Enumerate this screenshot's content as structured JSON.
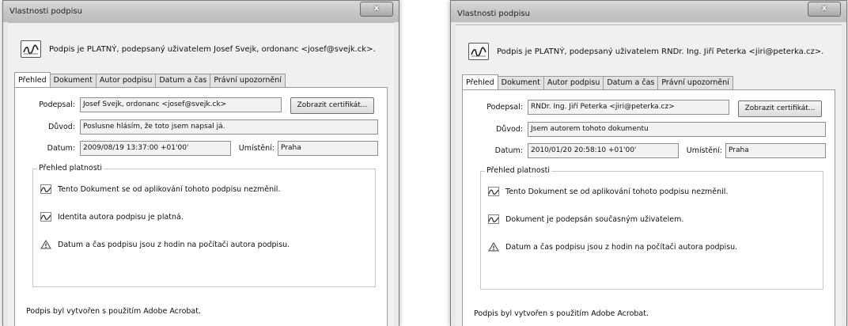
{
  "left": {
    "window_title": "Vlastnosti podpisu",
    "close_glyph": "x",
    "status": "Podpis je PLATNÝ, podepsaný uživatelem Josef Svejk, ordonanc <josef@svejk.ck>.",
    "tabs": [
      "Přehled",
      "Dokument",
      "Autor podpisu",
      "Datum a čas",
      "Právní upozornění"
    ],
    "signed_by_label": "Podepsal:",
    "signed_by_value": "Josef Svejk, ordonanc <josef@svejk.ck>",
    "show_cert_button": "Zobrazit certifikát...",
    "reason_label": "Důvod:",
    "reason_value": "Poslusne hlásím, že toto jsem napsal já.",
    "date_label": "Datum:",
    "date_value": "2009/08/19 13:37:00 +01'00'",
    "location_label": "Umístění:",
    "location_value": "Praha",
    "validity_title": "Přehled platnosti",
    "validity_items": [
      {
        "icon": "signature-ok-icon",
        "text": "Tento Dokument se od aplikování tohoto podpisu nezměnil."
      },
      {
        "icon": "signature-ok-icon",
        "text": "Identita autora podpisu je platná."
      },
      {
        "icon": "warning-icon",
        "text": "Datum a čas podpisu jsou z hodin na počítači autora podpisu."
      }
    ],
    "footer": "Podpis byl vytvořen s použitím Adobe Acrobat."
  },
  "right": {
    "window_title": "Vlastnosti podpisu",
    "close_glyph": "x",
    "status": "Podpis je PLATNÝ, podepsaný uživatelem RNDr. Ing. Jiří Peterka <jiri@peterka.cz>.",
    "tabs": [
      "Přehled",
      "Dokument",
      "Autor podpisu",
      "Datum a čas",
      "Právní upozornění"
    ],
    "signed_by_label": "Podepsal:",
    "signed_by_value": "RNDr. Ing. Jiří Peterka <jiri@peterka.cz>",
    "show_cert_button": "Zobrazit certifikát...",
    "reason_label": "Důvod:",
    "reason_value": "Jsem autorem tohoto dokumentu",
    "date_label": "Datum:",
    "date_value": "2010/01/20 20:58:10 +01'00'",
    "location_label": "Umístění:",
    "location_value": "Praha",
    "validity_title": "Přehled platnosti",
    "validity_items": [
      {
        "icon": "signature-ok-icon",
        "text": "Tento Dokument se od aplikování tohoto podpisu nezměnil."
      },
      {
        "icon": "signature-ok-icon",
        "text": "Dokument je podepsán současným uživatelem."
      },
      {
        "icon": "warning-icon",
        "text": "Datum a čas podpisu jsou z hodin na počítači autora podpisu."
      }
    ],
    "footer": "Podpis byl vytvořen s použitím Adobe Acrobat."
  }
}
